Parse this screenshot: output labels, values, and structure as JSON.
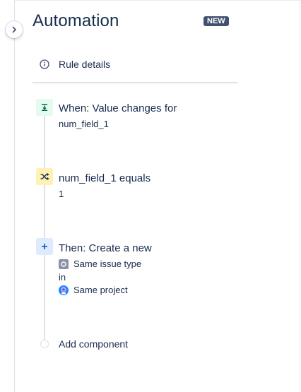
{
  "panel": {
    "title": "Automation",
    "badge": "NEW",
    "rule_details_label": "Rule details"
  },
  "steps": [
    {
      "kind": "trigger",
      "icon": "trigger-icon",
      "color": "#e3fcef",
      "icon_color": "#006644",
      "title": "When: Value changes for",
      "subtitle": "num_field_1"
    },
    {
      "kind": "condition",
      "icon": "condition-shuffle-icon",
      "color": "#fff0b3",
      "icon_color": "#172b4d",
      "title": "num_field_1 equals",
      "subtitle": "1"
    },
    {
      "kind": "action",
      "icon": "plus-icon",
      "color": "#deebff",
      "icon_color": "#0052cc",
      "title": "Then: Create a new",
      "details": {
        "issue_type_label": "Same issue type",
        "in_label": "in",
        "project_label": "Same project"
      }
    }
  ],
  "add_component_label": "Add component",
  "colors": {
    "badge": "#42526e",
    "text": "#172b4d",
    "line": "#dfe1e6"
  }
}
